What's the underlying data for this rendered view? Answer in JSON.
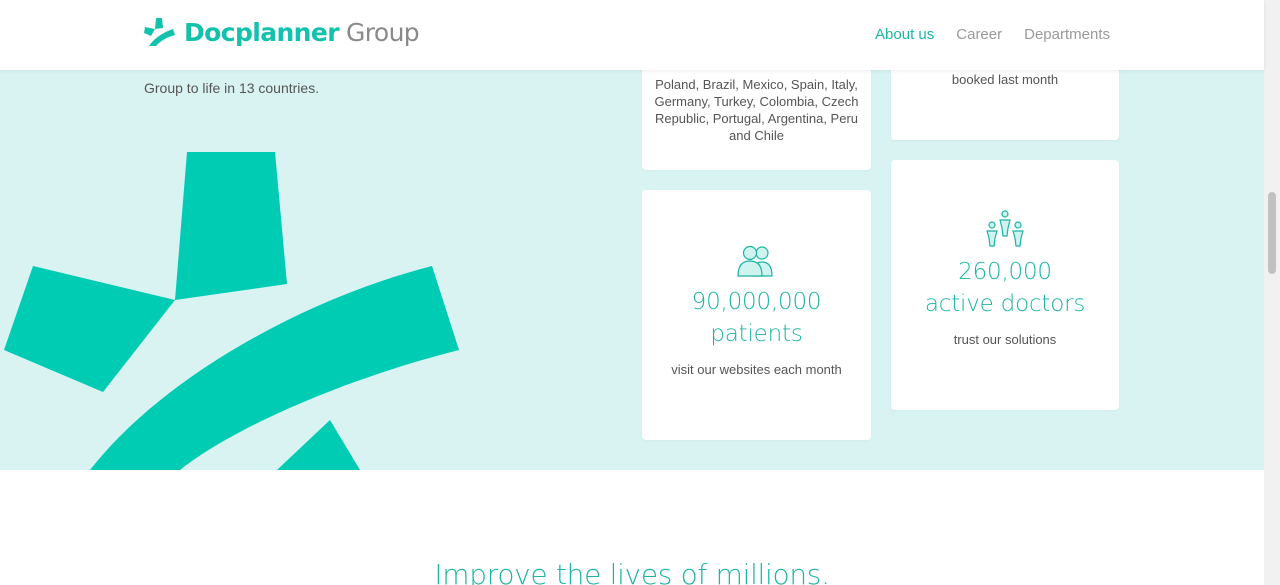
{
  "header": {
    "logo_primary": "Docplanner",
    "logo_secondary": "Group",
    "nav": [
      {
        "label": "About us",
        "active": true
      },
      {
        "label": "Career",
        "active": false
      },
      {
        "label": "Departments",
        "active": false
      }
    ]
  },
  "intro": {
    "text": "Group to life in 13 countries."
  },
  "stats": {
    "countries": {
      "text": "Poland, Brazil, Mexico, Spain, Italy, Germany, Turkey, Colombia, Czech Republic, Portugal, Argentina, Peru and Chile"
    },
    "bookings": {
      "desc": "booked last month"
    },
    "patients": {
      "icon": "patients-icon",
      "number": "90,000,000",
      "label": "patients",
      "desc": "visit our websites each month"
    },
    "doctors": {
      "icon": "doctors-icon",
      "number": "260,000",
      "label": "active doctors",
      "desc": "trust our solutions"
    }
  },
  "section": {
    "title": "Improve the lives of millions."
  },
  "colors": {
    "brand": "#13c2ac",
    "accent_text": "#1cb5a5",
    "hero_bg": "#d9f3f3",
    "card_bg": "#ffffff"
  }
}
